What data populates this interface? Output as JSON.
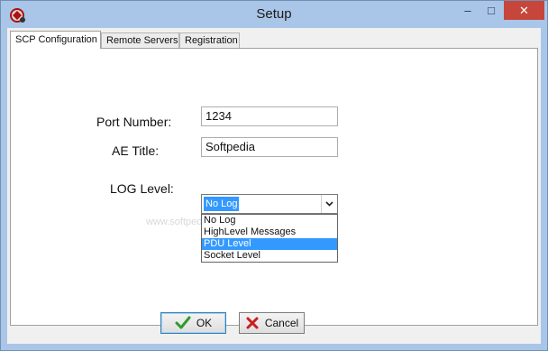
{
  "window": {
    "title": "Setup",
    "controls": {
      "minimize": "–",
      "maximize": "□",
      "close": "✕"
    }
  },
  "tabs": [
    {
      "label": "SCP Configuration",
      "active": true
    },
    {
      "label": "Remote Servers",
      "active": false
    },
    {
      "label": "Registration",
      "active": false
    }
  ],
  "form": {
    "port_label": "Port Number:",
    "port_value": "1234",
    "ae_label": "AE Title:",
    "ae_value": "Softpedia",
    "log_label": "LOG Level:",
    "log_value": "No Log",
    "log_options": [
      "No Log",
      "HighLevel Messages",
      "PDU Level",
      "Socket Level"
    ],
    "log_highlighted": "PDU Level"
  },
  "watermark": "www.softpedia.com",
  "buttons": {
    "ok": "OK",
    "cancel": "Cancel"
  },
  "icons": {
    "app": "app-icon",
    "ok": "check-icon",
    "cancel": "x-icon",
    "dropdown": "chevron-down-icon"
  },
  "colors": {
    "titlebar": "#a9c6e8",
    "close": "#c7463b",
    "selection": "#3399ff",
    "ok_check": "#2e9b2e",
    "cancel_x": "#c8201e"
  }
}
